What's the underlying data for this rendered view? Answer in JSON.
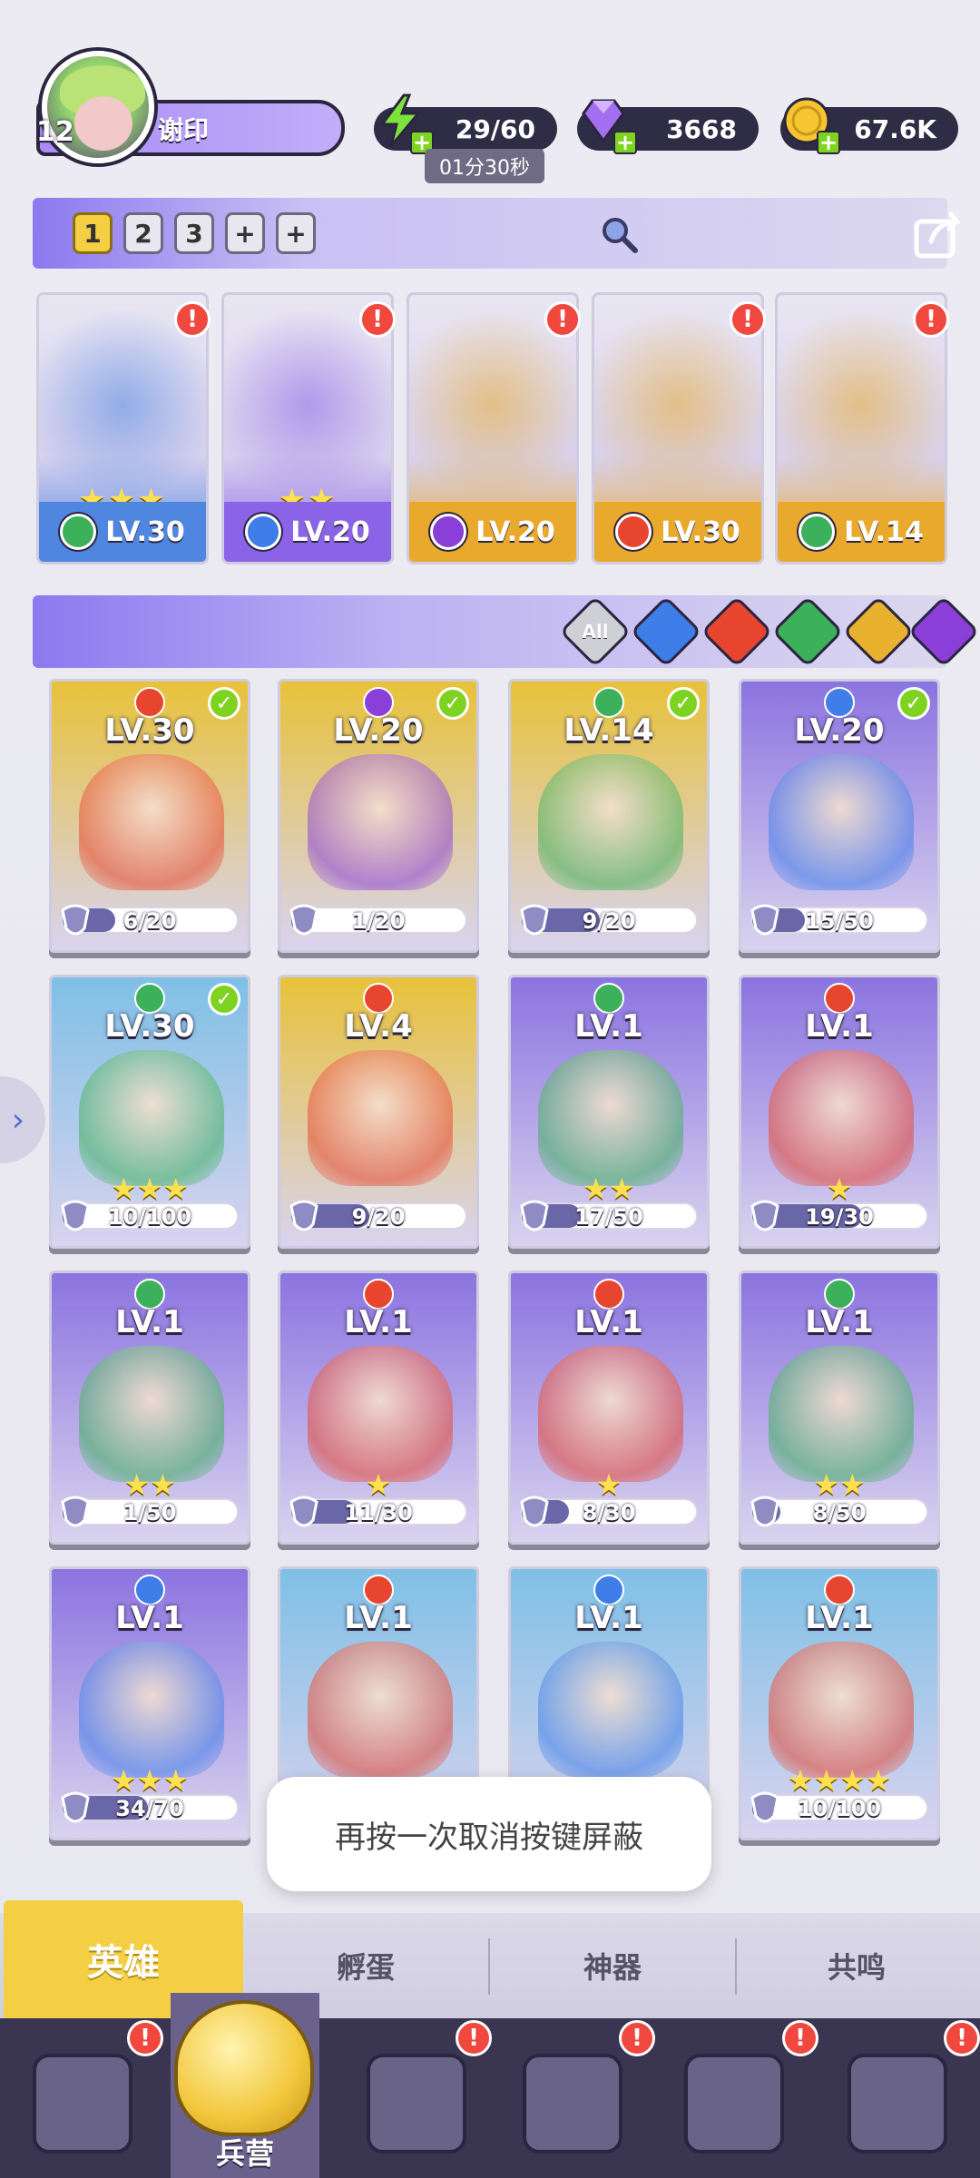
{
  "player": {
    "level": "12",
    "name": "谢印"
  },
  "resources": {
    "energy": {
      "icon": "lightning-icon",
      "value": "29/60",
      "timer": "01分30秒"
    },
    "gems": {
      "icon": "diamond-icon",
      "value": "3668"
    },
    "coins": {
      "icon": "coin-icon",
      "value": "67.6K"
    }
  },
  "team_tabs": [
    "1",
    "2",
    "3",
    "+",
    "+"
  ],
  "lineup": [
    {
      "level": "LV.30",
      "stars": "★★★",
      "element": "green",
      "bg": "#4f86e0",
      "alert": "!"
    },
    {
      "level": "LV.20",
      "stars": "★★",
      "element": "blue",
      "bg": "#8a63e6",
      "alert": "!"
    },
    {
      "level": "LV.20",
      "stars": "",
      "element": "purple",
      "bg": "#e8a92c",
      "alert": "!"
    },
    {
      "level": "LV.30",
      "stars": "",
      "element": "red",
      "bg": "#e8a92c",
      "alert": "!"
    },
    {
      "level": "LV.14",
      "stars": "",
      "element": "green",
      "bg": "#e8a92c",
      "alert": "!"
    }
  ],
  "filters": [
    {
      "label": "All",
      "color": "#cfcfd6"
    },
    {
      "label": "",
      "color": "#3f7ee8"
    },
    {
      "label": "",
      "color": "#e8452f"
    },
    {
      "label": "",
      "color": "#3cb05a"
    },
    {
      "label": "",
      "color": "#e8b22f"
    },
    {
      "label": "",
      "color": "#8a3fd9"
    }
  ],
  "heroes": [
    {
      "level": "LV.30",
      "element": "red",
      "progress": "6/20",
      "fraction": 0.3,
      "stars": "",
      "deployed": true,
      "bg": "#e8c23a"
    },
    {
      "level": "LV.20",
      "element": "purple",
      "progress": "1/20",
      "fraction": 0.05,
      "stars": "",
      "deployed": true,
      "bg": "#e8c23a"
    },
    {
      "level": "LV.14",
      "element": "green",
      "progress": "9/20",
      "fraction": 0.45,
      "stars": "",
      "deployed": true,
      "bg": "#e8c23a"
    },
    {
      "level": "LV.20",
      "element": "blue",
      "progress": "15/50",
      "fraction": 0.3,
      "stars": "",
      "deployed": true,
      "bg": "#8b74e0"
    },
    {
      "level": "LV.30",
      "element": "green",
      "progress": "10/100",
      "fraction": 0.1,
      "stars": "★★★",
      "deployed": true,
      "bg": "#7fc0e6"
    },
    {
      "level": "LV.4",
      "element": "red",
      "progress": "9/20",
      "fraction": 0.45,
      "stars": "",
      "deployed": false,
      "bg": "#e8c23a"
    },
    {
      "level": "LV.1",
      "element": "green",
      "progress": "17/50",
      "fraction": 0.34,
      "stars": "★★",
      "deployed": false,
      "bg": "#8b74e0"
    },
    {
      "level": "LV.1",
      "element": "red",
      "progress": "19/30",
      "fraction": 0.63,
      "stars": "★",
      "deployed": false,
      "bg": "#8b74e0"
    },
    {
      "level": "LV.1",
      "element": "green",
      "progress": "1/50",
      "fraction": 0.02,
      "stars": "★★",
      "deployed": false,
      "bg": "#8b74e0"
    },
    {
      "level": "LV.1",
      "element": "red",
      "progress": "11/30",
      "fraction": 0.37,
      "stars": "★",
      "deployed": false,
      "bg": "#8b74e0"
    },
    {
      "level": "LV.1",
      "element": "red",
      "progress": "8/30",
      "fraction": 0.27,
      "stars": "★",
      "deployed": false,
      "bg": "#8b74e0"
    },
    {
      "level": "LV.1",
      "element": "green",
      "progress": "8/50",
      "fraction": 0.16,
      "stars": "★★",
      "deployed": false,
      "bg": "#8b74e0"
    },
    {
      "level": "LV.1",
      "element": "blue",
      "progress": "34/70",
      "fraction": 0.49,
      "stars": "★★★",
      "deployed": false,
      "bg": "#8b74e0"
    },
    {
      "level": "LV.1",
      "element": "red",
      "progress": "",
      "fraction": 0,
      "stars": "",
      "deployed": false,
      "bg": "#7fc0e6"
    },
    {
      "level": "LV.1",
      "element": "blue",
      "progress": "",
      "fraction": 0,
      "stars": "",
      "deployed": false,
      "bg": "#7fc0e6"
    },
    {
      "level": "LV.1",
      "element": "red",
      "progress": "10/100",
      "fraction": 0.1,
      "stars": "★★★★",
      "deployed": false,
      "bg": "#7fc0e6"
    }
  ],
  "toast": "再按一次取消按键屏蔽",
  "subtabs": [
    "英雄",
    "孵蛋",
    "神器",
    "共鸣"
  ],
  "nav": {
    "active_label": "兵营",
    "items": [
      "cards-icon",
      "barracks-icon",
      "map-icon",
      "castle-icon",
      "mushroom-icon",
      "banner-icon"
    ]
  },
  "colors": {
    "accent": "#f5cf43",
    "nav_bg": "#3a3550",
    "alert": "#f0483e"
  }
}
